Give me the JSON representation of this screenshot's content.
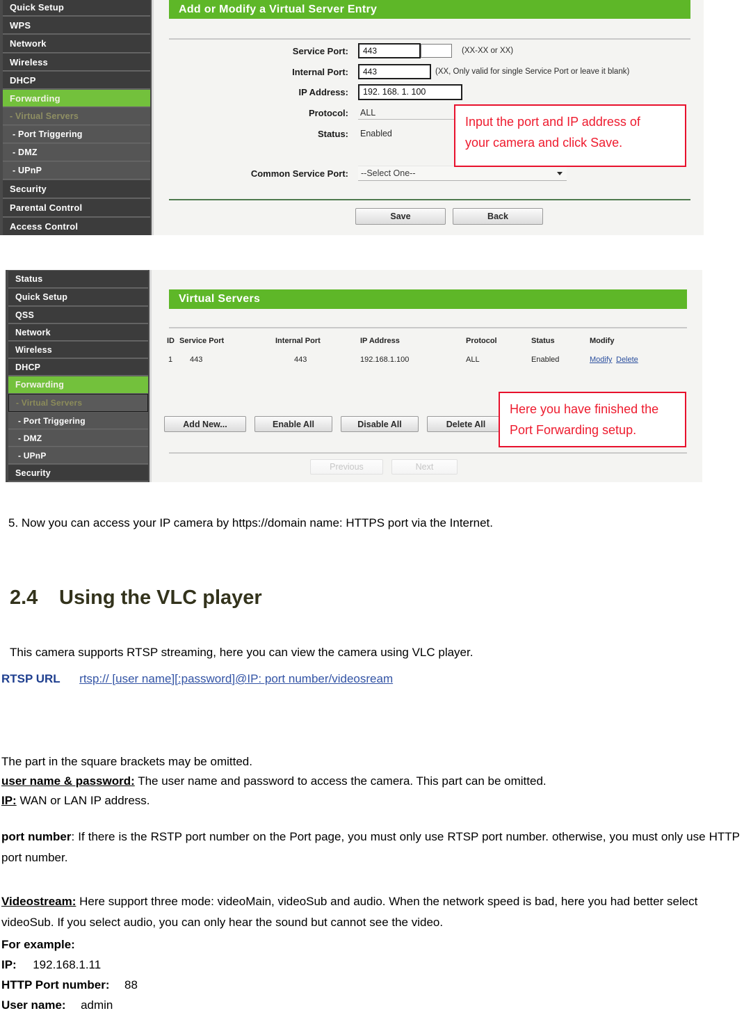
{
  "screenshot_add_entry": {
    "sidebar": [
      {
        "label": "Quick Setup",
        "style": "dark"
      },
      {
        "label": "WPS",
        "style": "dark"
      },
      {
        "label": "Network",
        "style": "dark"
      },
      {
        "label": "Wireless",
        "style": "dark"
      },
      {
        "label": "DHCP",
        "style": "dark"
      },
      {
        "label": "Forwarding",
        "style": "active"
      },
      {
        "label": "- Virtual Servers",
        "style": "virtual-grey"
      },
      {
        "label": "- Port Triggering",
        "style": "sub"
      },
      {
        "label": "- DMZ",
        "style": "sub"
      },
      {
        "label": "- UPnP",
        "style": "sub"
      },
      {
        "label": "Security",
        "style": "dark"
      },
      {
        "label": "Parental Control",
        "style": "dark"
      },
      {
        "label": "Access Control",
        "style": "dark"
      }
    ],
    "title": "Add or Modify a Virtual Server Entry",
    "fields": {
      "service_port_label": "Service Port:",
      "service_port_value": "443",
      "service_port_hint": "(XX-XX or XX)",
      "internal_port_label": "Internal Port:",
      "internal_port_value": "443",
      "internal_port_hint": "(XX, Only valid for single Service Port or leave it blank)",
      "ip_address_label": "IP Address:",
      "ip_address_value": "192. 168. 1. 100",
      "protocol_label": "Protocol:",
      "protocol_value": "ALL",
      "status_label": "Status:",
      "status_value": "Enabled",
      "common_service_port_label": "Common Service Port:",
      "common_service_port_value": "--Select One--"
    },
    "buttons": {
      "save": "Save",
      "back": "Back"
    },
    "callout": {
      "line1": "Input the port and IP address of",
      "line2": "your camera and click Save."
    }
  },
  "screenshot_virtual_servers": {
    "sidebar": [
      {
        "label": "Status",
        "style": "dark"
      },
      {
        "label": "Quick Setup",
        "style": "dark"
      },
      {
        "label": "QSS",
        "style": "dark"
      },
      {
        "label": "Network",
        "style": "dark"
      },
      {
        "label": "Wireless",
        "style": "dark"
      },
      {
        "label": "DHCP",
        "style": "dark"
      },
      {
        "label": "Forwarding",
        "style": "active"
      },
      {
        "label": "- Virtual Servers",
        "style": "selected-sub"
      },
      {
        "label": "- Port Triggering",
        "style": "sub"
      },
      {
        "label": "- DMZ",
        "style": "sub"
      },
      {
        "label": "- UPnP",
        "style": "sub"
      },
      {
        "label": "Security",
        "style": "dark"
      }
    ],
    "title": "Virtual Servers",
    "table": {
      "headers": [
        "ID",
        "Service Port",
        "Internal Port",
        "IP Address",
        "Protocol",
        "Status",
        "Modify"
      ],
      "rows": [
        {
          "id": "1",
          "service_port": "443",
          "internal_port": "443",
          "ip_address": "192.168.1.100",
          "protocol": "ALL",
          "status": "Enabled",
          "modify": "Modify",
          "delete": "Delete"
        }
      ]
    },
    "buttons": {
      "add_new": "Add New...",
      "enable_all": "Enable All",
      "disable_all": "Disable All",
      "delete_all": "Delete All",
      "previous": "Previous",
      "next": "Next"
    },
    "callout": {
      "line1": "Here you have finished the",
      "line2": "Port Forwarding setup."
    }
  },
  "document": {
    "step5": "5.   Now you can access your IP camera by https://domain name: HTTPS port via the Internet.",
    "heading_number": "2.4",
    "heading_title": "Using the VLC player",
    "intro": "This camera supports RTSP streaming, here you can view the camera using VLC player.",
    "rtsp_label": "RTSP URL",
    "rtsp_url": "rtsp:// [user name][:password]@IP: port number/videosream",
    "brackets_note": "The part in the square brackets may be omitted.",
    "username_password_label": "user name & password:",
    "username_password_text": " The user name and password to access the camera. This part can be omitted.",
    "ip_label": "IP:",
    "ip_text": " WAN or LAN IP address.",
    "port_number_label": "port number",
    "port_number_text": ": If there is the RSTP port number on the Port page, you must only use RTSP port number. otherwise, you must only use HTTP port number.",
    "videostream_label": "Videostream:",
    "videostream_text": " Here support three mode: videoMain, videoSub and audio. When the network speed is bad, here you had better select videoSub. If you select audio, you can only hear the sound but cannot see the video.",
    "for_example_label": "For example:",
    "example_ip_label": "IP:",
    "example_ip_value": "192.168.1.11",
    "example_http_port_label": "HTTP Port number:",
    "example_http_port_value": "88",
    "example_user_label": "User name:",
    "example_user_value": "admin"
  },
  "colors": {
    "green_header": "#5eb728",
    "sidebar": "#4a4a4a",
    "callout_red": "#e8112d",
    "heading_olive": "#33331c",
    "link_blue": "#3354a5"
  }
}
